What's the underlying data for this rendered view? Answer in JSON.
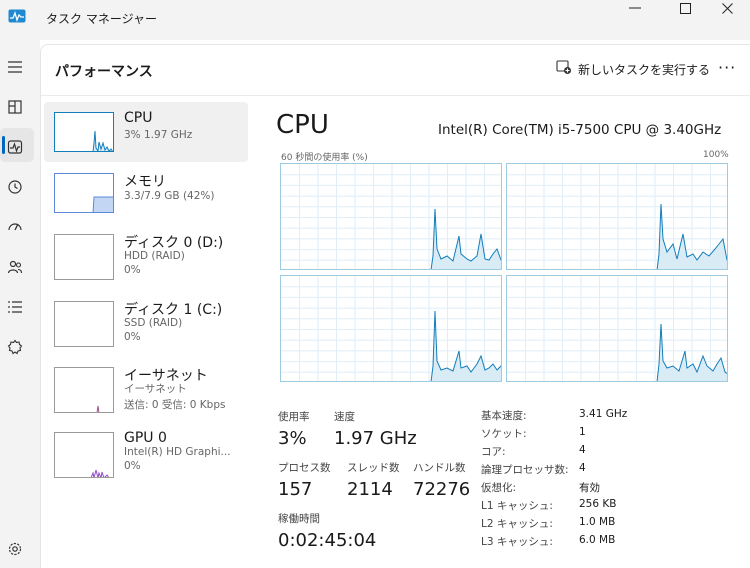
{
  "window": {
    "title": "タスク マネージャー",
    "controls": {
      "minimize": "—",
      "maximize": "☐",
      "close": "✕"
    }
  },
  "header": {
    "page_title": "パフォーマンス",
    "new_task_label": "新しいタスクを実行する",
    "more_label": "···"
  },
  "nav": {
    "items": [
      {
        "name": "menu",
        "icon": "hamburger-icon"
      },
      {
        "name": "processes",
        "icon": "processes-icon"
      },
      {
        "name": "performance",
        "icon": "performance-icon",
        "active": true
      },
      {
        "name": "app-history",
        "icon": "history-icon"
      },
      {
        "name": "startup",
        "icon": "startup-icon"
      },
      {
        "name": "users",
        "icon": "users-icon"
      },
      {
        "name": "details",
        "icon": "details-icon"
      },
      {
        "name": "services",
        "icon": "services-icon"
      },
      {
        "name": "settings",
        "icon": "settings-icon"
      }
    ]
  },
  "resources": [
    {
      "name": "CPU",
      "sub1": "3%  1.97 GHz",
      "selected": true,
      "graph": "cpu"
    },
    {
      "name": "メモリ",
      "sub1": "3.3/7.9 GB (42%)",
      "graph": "memory",
      "memory_fraction": 0.42
    },
    {
      "name": "ディスク 0 (D:)",
      "sub1": "HDD (RAID)",
      "sub2": "0%",
      "graph": "empty"
    },
    {
      "name": "ディスク 1 (C:)",
      "sub1": "SSD (RAID)",
      "sub2": "0%",
      "graph": "empty"
    },
    {
      "name": "イーサネット",
      "sub1": "イーサネット",
      "sub2": "送信: 0 受信: 0 Kbps",
      "graph": "ethernet"
    },
    {
      "name": "GPU 0",
      "sub1": "Intel(R) HD Graphi...",
      "sub2": "0%",
      "graph": "gpu"
    }
  ],
  "detail": {
    "title": "CPU",
    "model": "Intel(R) Core(TM) i5-7500 CPU @ 3.40GHz",
    "graph_caption": "60 秒間の使用率 (%)",
    "graph_max": "100%",
    "stats": {
      "utilization_label": "使用率",
      "utilization": "3%",
      "speed_label": "速度",
      "speed": "1.97 GHz",
      "processes_label": "プロセス数",
      "processes": "157",
      "threads_label": "スレッド数",
      "threads": "2114",
      "handles_label": "ハンドル数",
      "handles": "72276",
      "uptime_label": "稼働時間",
      "uptime": "0:02:45:04"
    },
    "specs": [
      {
        "key": "基本速度:",
        "value": "3.41 GHz"
      },
      {
        "key": "ソケット:",
        "value": "1"
      },
      {
        "key": "コア:",
        "value": "4"
      },
      {
        "key": "論理プロセッサ数:",
        "value": "4"
      },
      {
        "key": "仮想化:",
        "value": "有効"
      },
      {
        "key": "L1 キャッシュ:",
        "value": "256 KB"
      },
      {
        "key": "L2 キャッシュ:",
        "value": "1.0 MB"
      },
      {
        "key": "L3 キャッシュ:",
        "value": "6.0 MB"
      }
    ]
  },
  "colors": {
    "cpu_line": "#117dbb",
    "cpu_fill": "#d9ebf5",
    "memory_line": "#5b8bd8",
    "memory_fill": "#c3d7f5",
    "ethernet_line": "#a44d8e",
    "gpu_line": "#8e4ec6"
  }
}
